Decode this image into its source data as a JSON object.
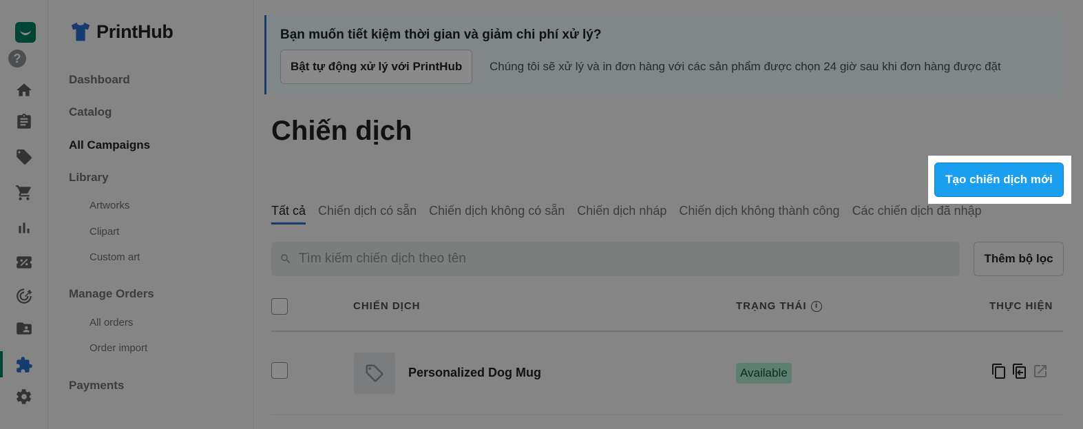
{
  "rail": {
    "icons": [
      "shop-logo-icon",
      "help-icon",
      "home-icon",
      "orders-icon",
      "tags-icon",
      "cart-icon",
      "analytics-icon",
      "discount-icon",
      "target-icon",
      "customers-icon",
      "apps-puzzle-icon",
      "settings-icon"
    ],
    "help_label": "?"
  },
  "sidebar": {
    "brand": "PrintHub",
    "items": [
      {
        "label": "Dashboard"
      },
      {
        "label": "Catalog"
      },
      {
        "label": "All Campaigns",
        "current": true
      },
      {
        "label": "Library"
      },
      {
        "label": "Artworks",
        "sub": true
      },
      {
        "label": "Clipart",
        "sub": true
      },
      {
        "label": "Custom art",
        "sub": true
      },
      {
        "label": "Manage Orders"
      },
      {
        "label": "All orders",
        "sub": true
      },
      {
        "label": "Order import",
        "sub": true
      },
      {
        "label": "Payments"
      }
    ]
  },
  "banner": {
    "title": "Bạn muốn tiết kiệm thời gian và giảm chi phí xử lý?",
    "button": "Bật tự động xử lý với PrintHub",
    "description": "Chúng tôi sẽ xử lý và in đơn hàng với các sản phẩm được chọn 24 giờ sau khi đơn hàng được đặt"
  },
  "page": {
    "title": "Chiến dịch",
    "create_button": "Tạo chiến dịch mới"
  },
  "tabs": [
    {
      "label": "Tất cả",
      "selected": true
    },
    {
      "label": "Chiến dịch có sẵn"
    },
    {
      "label": "Chiến dịch không có sẵn"
    },
    {
      "label": "Chiến dịch nháp"
    },
    {
      "label": "Chiến dịch không thành công"
    },
    {
      "label": "Các chiến dịch đã nhập"
    }
  ],
  "search": {
    "placeholder": "Tìm kiếm chiến dịch theo tên",
    "value": ""
  },
  "filter_button": "Thêm bộ lọc",
  "table": {
    "columns": {
      "campaign": "CHIẾN DỊCH",
      "status": "TRẠNG THÁI",
      "actions": "THỰC HIỆN"
    },
    "info_icon": "i",
    "rows": [
      {
        "name": "Personalized Dog Mug",
        "status": "Available",
        "actions": [
          "duplicate-icon",
          "copy-icon",
          "external-link-icon"
        ]
      }
    ]
  },
  "colors": {
    "primary_button": "#1a9ff0",
    "accent": "#2c6ecb",
    "available_badge": "#aee9d1",
    "overlay": "rgba(0,0,0,0.46)"
  }
}
